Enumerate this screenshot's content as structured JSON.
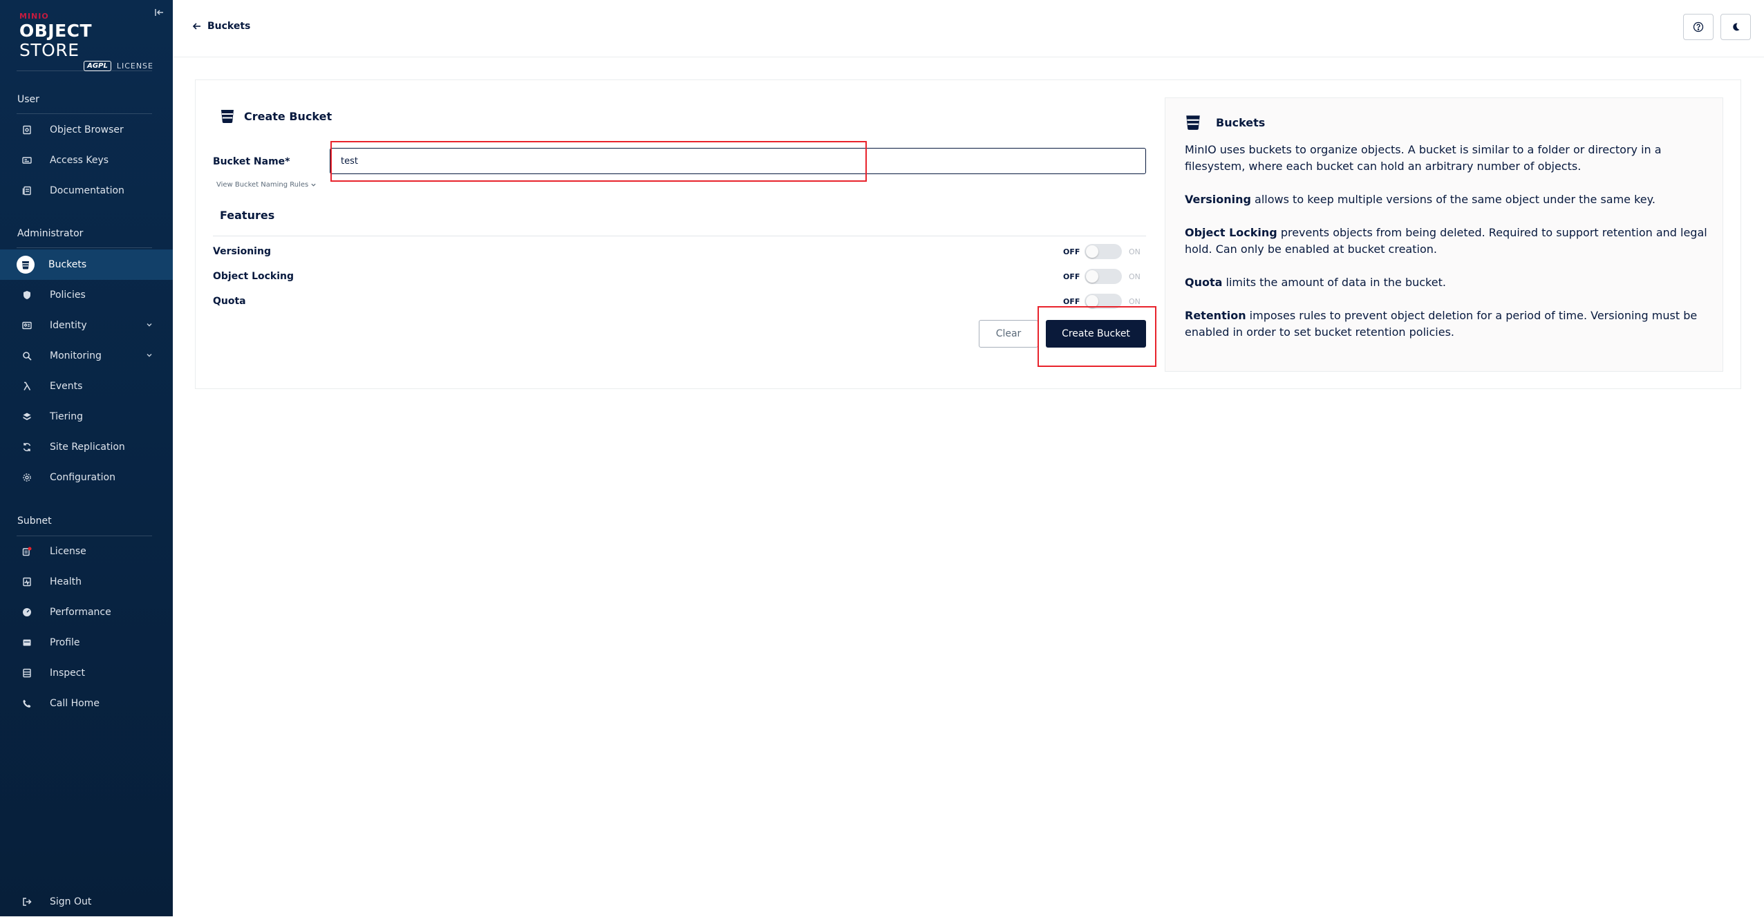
{
  "sidebar": {
    "logo": {
      "brand": "MINIO",
      "product_bold": "OBJECT",
      "product_light": "STORE",
      "agpl": "AGPL",
      "license": "LICENSE"
    },
    "sections": {
      "user": "User",
      "administrator": "Administrator",
      "subnet": "Subnet"
    },
    "user_items": [
      {
        "label": "Object Browser",
        "icon": "object-browser-icon"
      },
      {
        "label": "Access Keys",
        "icon": "access-keys-icon"
      },
      {
        "label": "Documentation",
        "icon": "documentation-icon"
      }
    ],
    "admin_items": [
      {
        "label": "Buckets",
        "icon": "bucket-icon",
        "active": true
      },
      {
        "label": "Policies",
        "icon": "policies-icon"
      },
      {
        "label": "Identity",
        "icon": "identity-icon",
        "expandable": true
      },
      {
        "label": "Monitoring",
        "icon": "monitoring-icon",
        "expandable": true
      },
      {
        "label": "Events",
        "icon": "lambda-icon"
      },
      {
        "label": "Tiering",
        "icon": "tiering-icon"
      },
      {
        "label": "Site Replication",
        "icon": "site-replication-icon"
      },
      {
        "label": "Configuration",
        "icon": "gear-icon"
      }
    ],
    "subnet_items": [
      {
        "label": "License",
        "icon": "license-icon"
      },
      {
        "label": "Health",
        "icon": "health-icon"
      },
      {
        "label": "Performance",
        "icon": "performance-icon"
      },
      {
        "label": "Profile",
        "icon": "profile-icon"
      },
      {
        "label": "Inspect",
        "icon": "inspect-icon"
      },
      {
        "label": "Call Home",
        "icon": "call-home-icon"
      }
    ],
    "sign_out": "Sign Out"
  },
  "header": {
    "back_label": "Buckets",
    "help_icon": "help-icon",
    "theme_icon": "moon-icon"
  },
  "form": {
    "title": "Create Bucket",
    "bucket_name_label": "Bucket Name*",
    "bucket_name_value": "test",
    "naming_rules_link": "View Bucket Naming Rules",
    "features_title": "Features",
    "features": [
      {
        "label": "Versioning",
        "off": "OFF",
        "on": "ON",
        "enabled": false
      },
      {
        "label": "Object Locking",
        "off": "OFF",
        "on": "ON",
        "enabled": false
      },
      {
        "label": "Quota",
        "off": "OFF",
        "on": "ON",
        "enabled": false
      }
    ],
    "clear_label": "Clear",
    "create_label": "Create Bucket"
  },
  "help": {
    "title": "Buckets",
    "intro": "MinIO uses buckets to organize objects. A bucket is similar to a folder or directory in a filesystem, where each bucket can hold an arbitrary number of objects.",
    "versioning_term": "Versioning",
    "versioning_text": " allows to keep multiple versions of the same object under the same key.",
    "locking_term": "Object Locking",
    "locking_text": " prevents objects from being deleted. Required to support retention and legal hold. Can only be enabled at bucket creation.",
    "quota_term": "Quota",
    "quota_text": " limits the amount of data in the bucket.",
    "retention_term": "Retention",
    "retention_text": " imposes rules to prevent object deletion for a period of time. Versioning must be enabled in order to set bucket retention policies."
  },
  "colors": {
    "sidebar_bg": "#0a2a4d",
    "active_item": "#124069",
    "primary": "#07193e",
    "create_button": "#0a1a3a",
    "highlight": "#e8232c"
  }
}
